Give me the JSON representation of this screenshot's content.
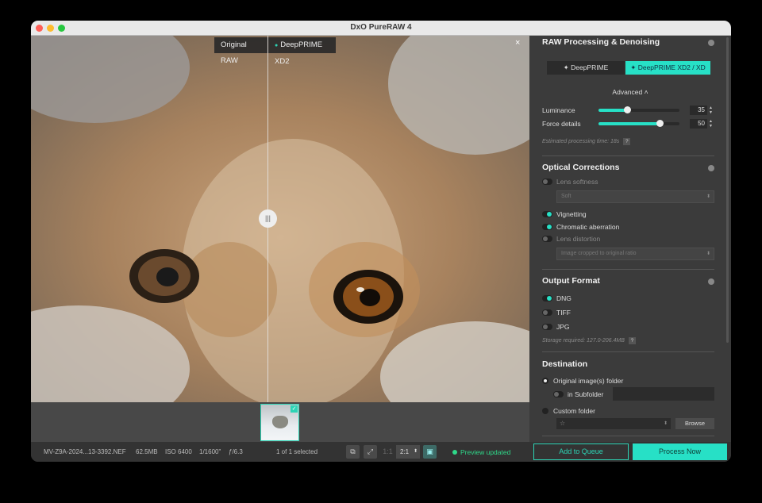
{
  "window": {
    "title": "DxO PureRAW 4"
  },
  "viewer": {
    "label_original": "Original RAW",
    "label_processed": "DeepPRIME XD2",
    "split_handle": "|||",
    "close": "×"
  },
  "filmstrip": {
    "thumb_check": "✓"
  },
  "status": {
    "filename": "MV-Z9A-2024...13-3392.NEF",
    "size": "62.5MB",
    "iso": "ISO 6400",
    "shutter": "1/1600\"",
    "aperture": "ƒ/6.3",
    "selection": "1 of 1 selected",
    "zoom_1to1": "1:1",
    "zoom_value": "2:1",
    "preview": "Preview updated",
    "add_to_queue": "Add to Queue",
    "process_now": "Process Now"
  },
  "panel": {
    "raw": {
      "title": "RAW Processing & Denoising",
      "mode_a": "✦ DeepPRIME",
      "mode_b": "✦ DeepPRIME XD2 / XD",
      "advanced": "Advanced ˄",
      "luminance_label": "Luminance",
      "luminance_value": "35",
      "luminance_fraction": 0.35,
      "force_label": "Force details",
      "force_value": "50",
      "force_fraction": 0.75,
      "time_hint": "Estimated processing time: 18s",
      "help": "?"
    },
    "optical": {
      "title": "Optical Corrections",
      "lens_softness": "Lens softness",
      "lens_softness_value": "Soft",
      "vignetting": "Vignetting",
      "chromatic": "Chromatic aberration",
      "distortion": "Lens distortion",
      "distortion_value": "Image cropped to original ratio"
    },
    "output": {
      "title": "Output Format",
      "dng": "DNG",
      "tiff": "TIFF",
      "jpg": "JPG",
      "storage_hint": "Storage required: 127.0-206.4MB",
      "help": "?"
    },
    "destination": {
      "title": "Destination",
      "original_folder": "Original image(s) folder",
      "subfolder": "in Subfolder",
      "custom_folder": "Custom folder",
      "star": "☆",
      "browse": "Browse"
    }
  },
  "colors": {
    "accent": "#27e0c6",
    "preview_green": "#2fd98a"
  }
}
